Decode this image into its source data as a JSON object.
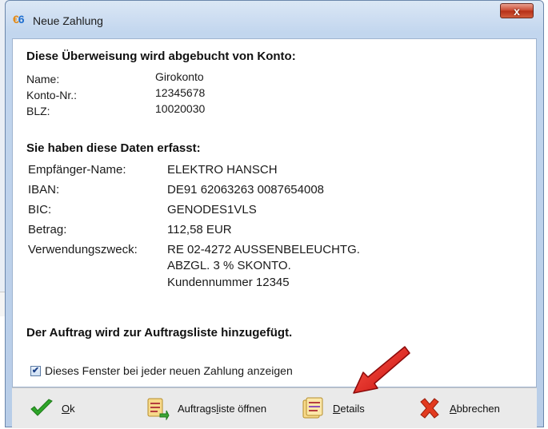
{
  "window": {
    "title": "Neue Zahlung",
    "close_label": "x"
  },
  "debit": {
    "heading": "Diese Überweisung wird abgebucht von Konto:",
    "rows": [
      {
        "label": "Name:",
        "value": "Girokonto"
      },
      {
        "label": "Konto-Nr.:",
        "value": "12345678"
      },
      {
        "label": "BLZ:",
        "value": "10020030"
      }
    ]
  },
  "captured": {
    "heading": "Sie haben diese Daten erfasst:",
    "rows": [
      {
        "label": "Empfänger-Name:",
        "value": "ELEKTRO HANSCH"
      },
      {
        "label": "IBAN:",
        "value": "DE91 62063263 0087654008"
      },
      {
        "label": "BIC:",
        "value": "GENODES1VLS"
      },
      {
        "label": "Betrag:",
        "value": "112,58 EUR"
      },
      {
        "label": "Verwendungszweck:",
        "value": "RE 02-4272 AUSSENBELEUCHTG."
      }
    ],
    "purpose_extra": [
      "ABZGL. 3 % SKONTO.",
      "Kundennummer 12345"
    ]
  },
  "notice": "Der Auftrag wird zur Auftragsliste hinzugefügt.",
  "checkbox": {
    "label": "Dieses Fenster bei jeder neuen Zahlung anzeigen",
    "checked": true
  },
  "buttons": {
    "ok": {
      "pre": "",
      "key": "O",
      "post": "k"
    },
    "list": {
      "pre": "Auftrags",
      "key": "l",
      "post": "iste öffnen"
    },
    "details": {
      "pre": "",
      "key": "D",
      "post": "etails"
    },
    "cancel": {
      "pre": "",
      "key": "A",
      "post": "bbrechen"
    }
  },
  "colors": {
    "accent": "#1f6fcf",
    "arrow": "#e01a1a"
  }
}
